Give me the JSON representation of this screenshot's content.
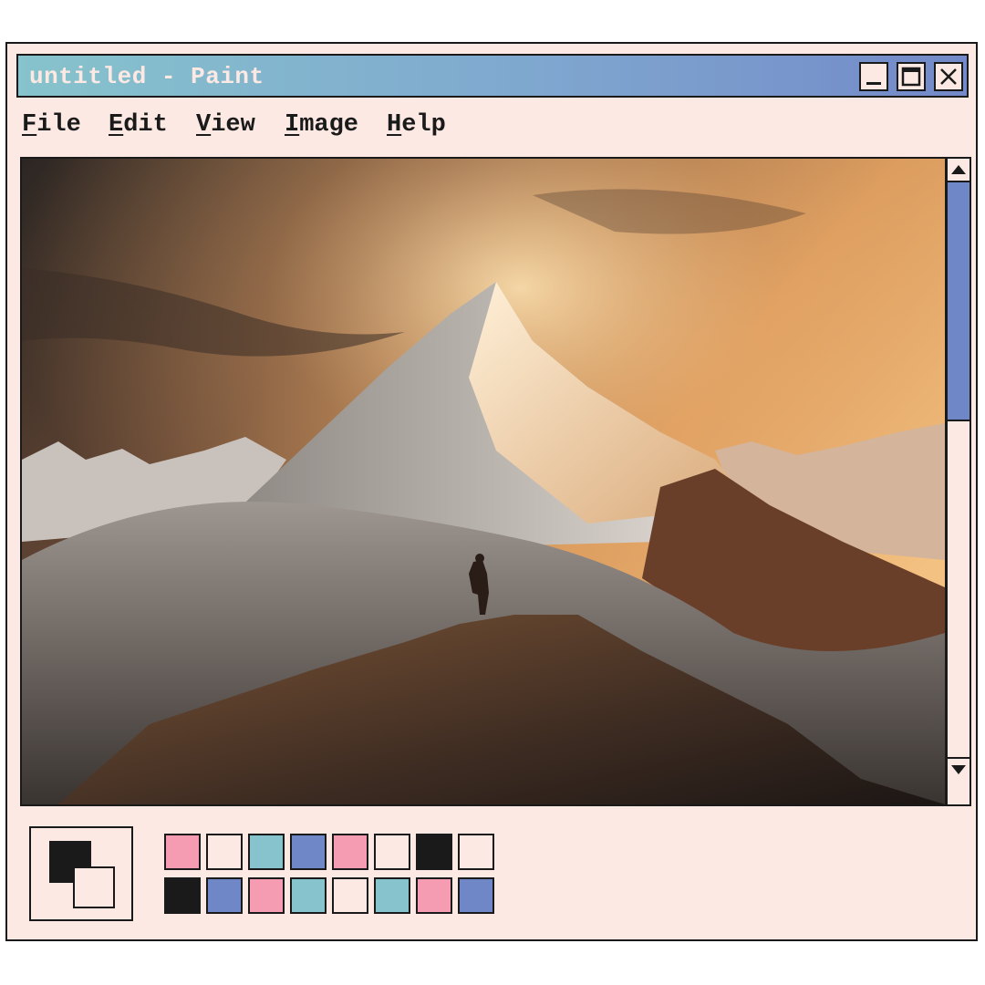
{
  "window": {
    "title": "untitled - Paint",
    "controls": {
      "minimize": "minimize-icon",
      "maximize": "maximize-icon",
      "close": "close-icon"
    }
  },
  "menu": [
    {
      "accel": "F",
      "rest": "ile"
    },
    {
      "accel": "E",
      "rest": "dit"
    },
    {
      "accel": "V",
      "rest": "iew"
    },
    {
      "accel": "I",
      "rest": "mage"
    },
    {
      "accel": "H",
      "rest": "elp"
    }
  ],
  "scrollbar": {
    "position": 0.38,
    "up_icon": "arrow-up-icon",
    "down_icon": "arrow-down-icon"
  },
  "colors": {
    "foreground": "#1a1a1a",
    "background": "#fde9e3",
    "title_gradient": [
      "#86c3cc",
      "#7389c9"
    ],
    "palette_row1": [
      "#f59cb2",
      "#fde9e3",
      "#86c3cc",
      "#6f86c7",
      "#f59cb2",
      "#fde9e3",
      "#1a1a1a",
      "#fde9e3"
    ],
    "palette_row2": [
      "#1a1a1a",
      "#6f86c7",
      "#f59cb2",
      "#86c3cc",
      "#fde9e3",
      "#86c3cc",
      "#f59cb2",
      "#6f86c7"
    ]
  }
}
